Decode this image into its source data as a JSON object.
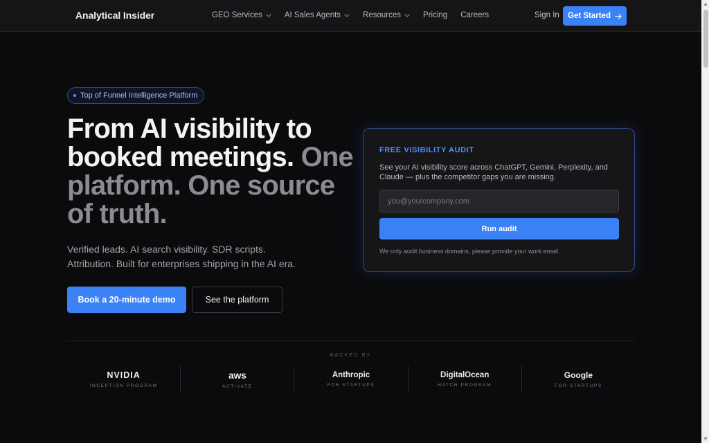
{
  "nav": {
    "brand": "Analytical Insider",
    "links": [
      {
        "label": "GEO Services",
        "has_dropdown": true
      },
      {
        "label": "AI Sales Agents",
        "has_dropdown": true
      },
      {
        "label": "Resources",
        "has_dropdown": true
      },
      {
        "label": "Pricing",
        "has_dropdown": false
      },
      {
        "label": "Careers",
        "has_dropdown": false
      }
    ],
    "sign_in": "Sign In",
    "cta": "Get Started",
    "cta_icon": "arrow-right-icon"
  },
  "hero": {
    "badge": "Top of Funnel Intelligence Platform",
    "headline_primary": "From AI visibility to booked meetings.",
    "headline_secondary": "One platform. One source of truth.",
    "subtext": "Verified leads. AI search visibility. SDR scripts. Attribution. Built for enterprises shipping in the AI era.",
    "primary_button": "Book a 20-minute demo",
    "secondary_button": "See the platform"
  },
  "audit": {
    "title": "FREE VISIBILITY AUDIT",
    "description": "See your AI visibility score across ChatGPT, Gemini, Perplexity, and Claude — plus the competitor gaps you are missing.",
    "email_placeholder": "you@yourcompany.com",
    "email_value": "",
    "button": "Run audit",
    "note": "We only audit business domains, please provide your work email."
  },
  "backers": {
    "label": "BACKED BY",
    "items": [
      {
        "name": "NVIDIA",
        "program": "INCEPTION PROGRAM"
      },
      {
        "name": "aws",
        "program": "ACTIVATE"
      },
      {
        "name": "Anthropic",
        "program": "FOR STARTUPS"
      },
      {
        "name": "DigitalOcean",
        "program": "HATCH PROGRAM"
      },
      {
        "name": "Google",
        "program": "FOR STARTUPS"
      }
    ]
  },
  "colors": {
    "background": "#0b0b0d",
    "accent": "#3b82f6",
    "muted_headline": "#8b8b90"
  }
}
